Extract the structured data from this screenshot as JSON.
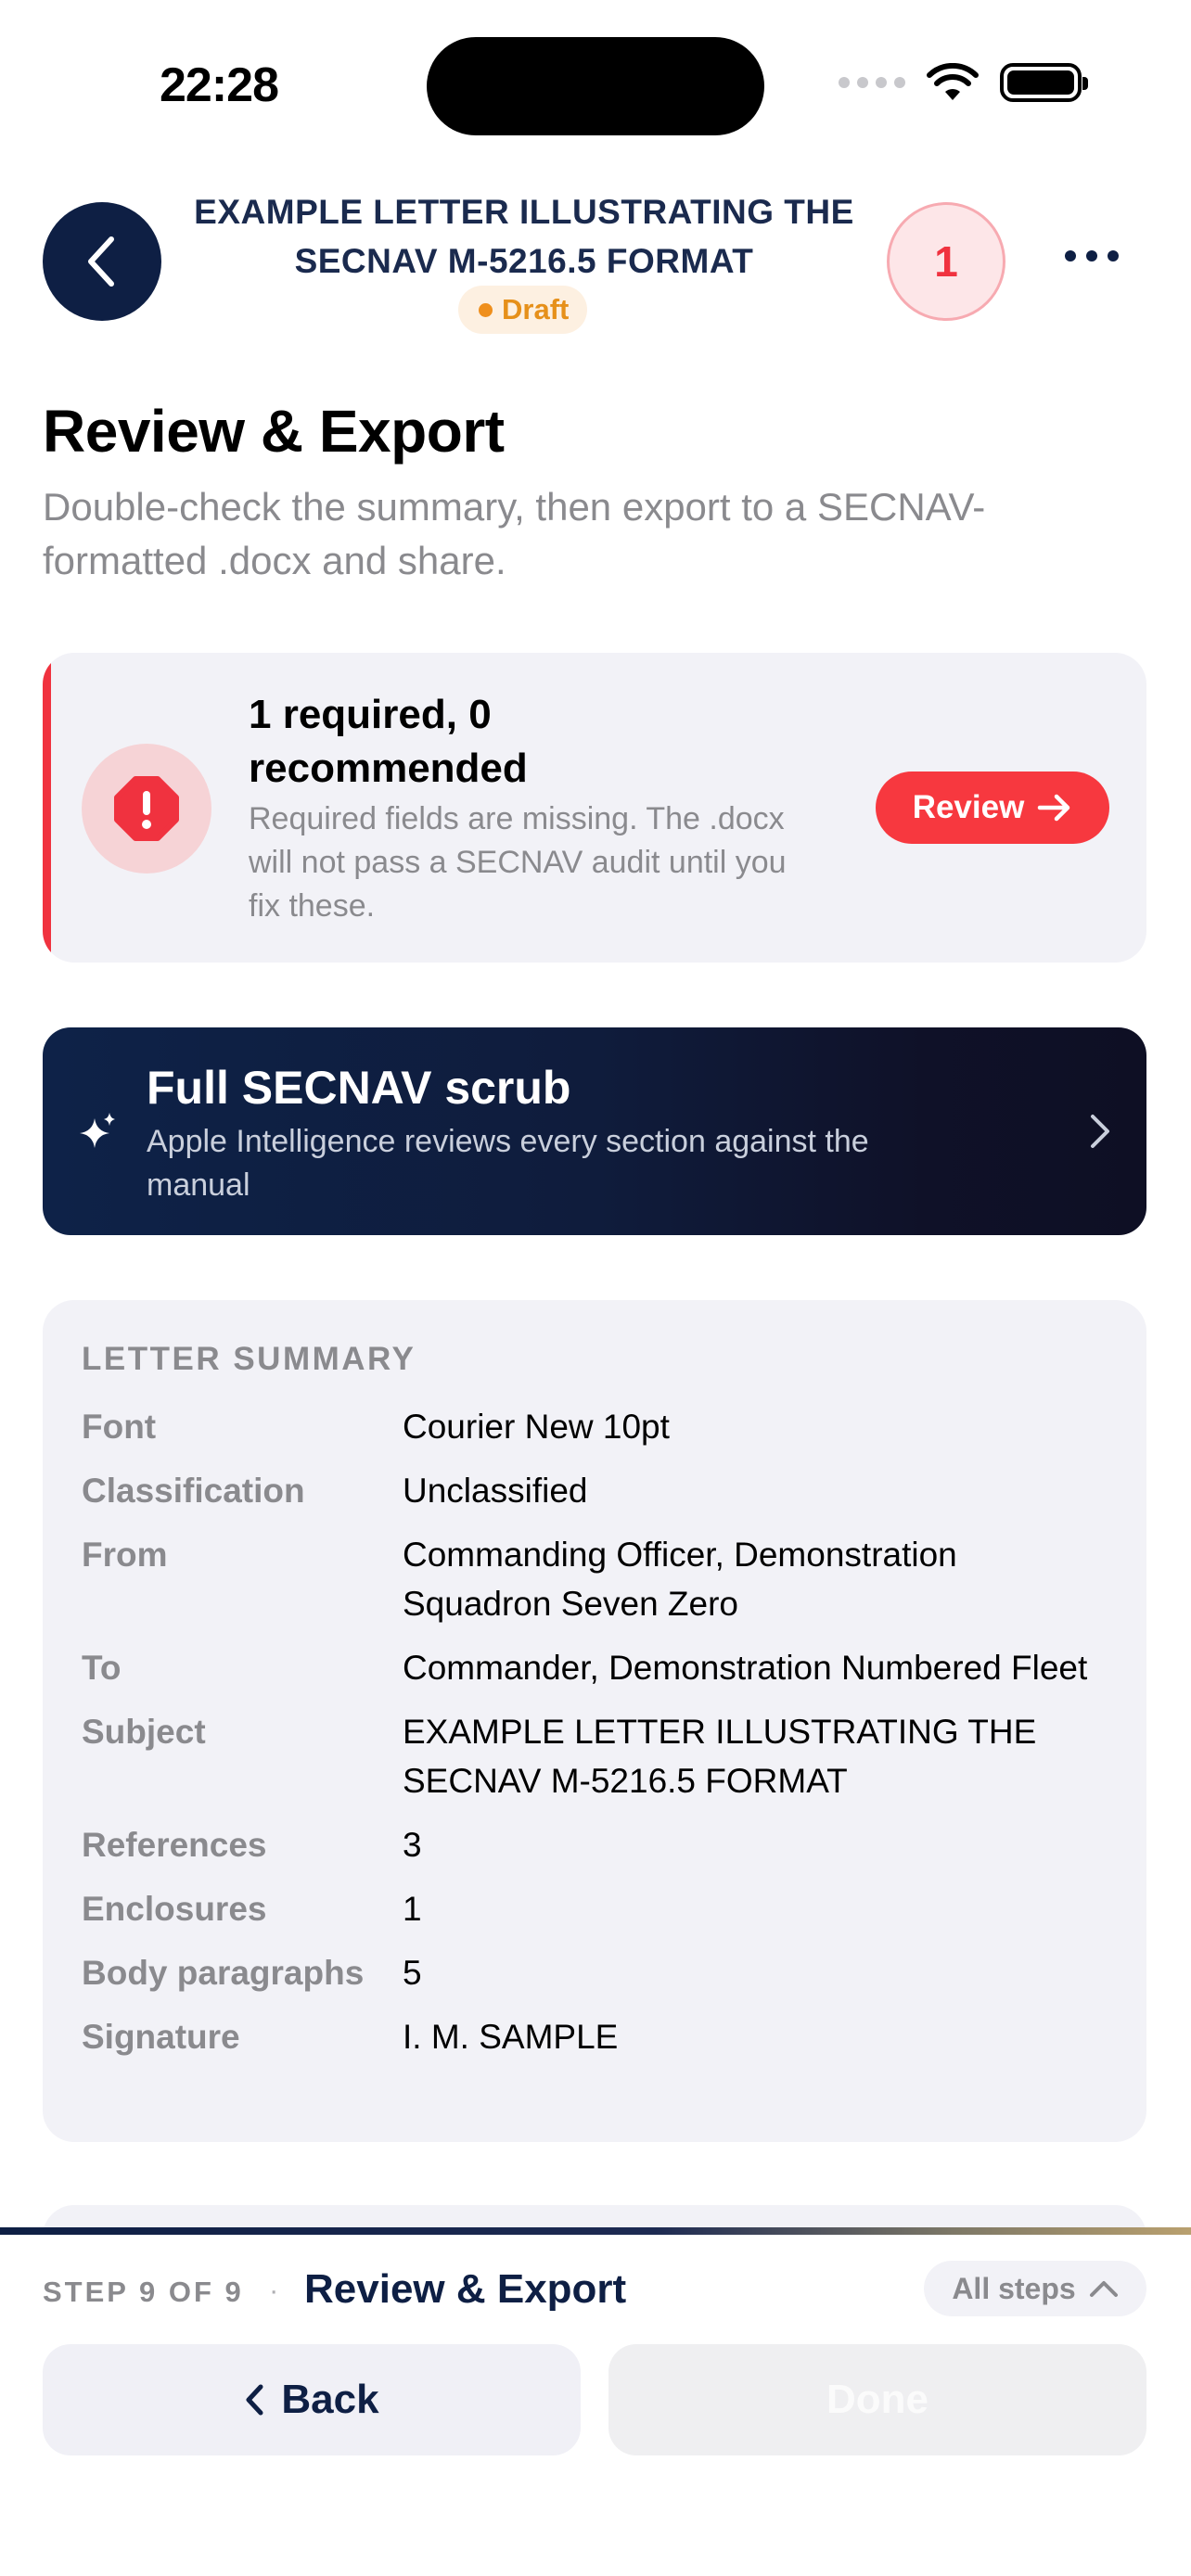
{
  "status_bar": {
    "time": "22:28"
  },
  "header": {
    "title": "EXAMPLE LETTER ILLUSTRATING THE SECNAV M-5216.5 FORMAT",
    "status_badge": "Draft",
    "issue_count": "1",
    "icons": [
      "chevron-left-icon",
      "ellipsis-icon"
    ]
  },
  "page": {
    "title": "Review & Export",
    "subtitle": "Double-check the summary, then export to a SECNAV-formatted .docx and share."
  },
  "alert": {
    "title": "1 required, 0 recommended",
    "description": "Required fields are missing. The .docx will not pass a SECNAV audit until you fix these.",
    "button_label": "Review",
    "icon": "exclamation-octagon-icon"
  },
  "scrub": {
    "title": "Full SECNAV scrub",
    "description": "Apple Intelligence reviews every section against the manual",
    "icon": "sparkles-icon"
  },
  "summary": {
    "heading": "LETTER SUMMARY",
    "rows": [
      {
        "label": "Font",
        "value": "Courier New 10pt"
      },
      {
        "label": "Classification",
        "value": "Unclassified"
      },
      {
        "label": "From",
        "value": "Commanding Officer, Demonstration Squadron Seven Zero"
      },
      {
        "label": "To",
        "value": "Commander, Demonstration Numbered Fleet"
      },
      {
        "label": "Subject",
        "value": "EXAMPLE LETTER ILLUSTRATING THE SECNAV M-5216.5 FORMAT"
      },
      {
        "label": "References",
        "value": "3"
      },
      {
        "label": "Enclosures",
        "value": "1"
      },
      {
        "label": "Body paragraphs",
        "value": "5"
      },
      {
        "label": "Signature",
        "value": "I. M. SAMPLE"
      }
    ]
  },
  "footer": {
    "step_label": "STEP 9 OF 9",
    "separator": "·",
    "step_title": "Review & Export",
    "all_steps_label": "All steps",
    "back_label": "Back",
    "done_label": "Done"
  },
  "colors": {
    "navy": "#0e1f44",
    "alert_red": "#f0323f",
    "draft_orange": "#e6901a",
    "card_gray": "#f2f2f7",
    "muted_text": "#8a8a8e"
  }
}
